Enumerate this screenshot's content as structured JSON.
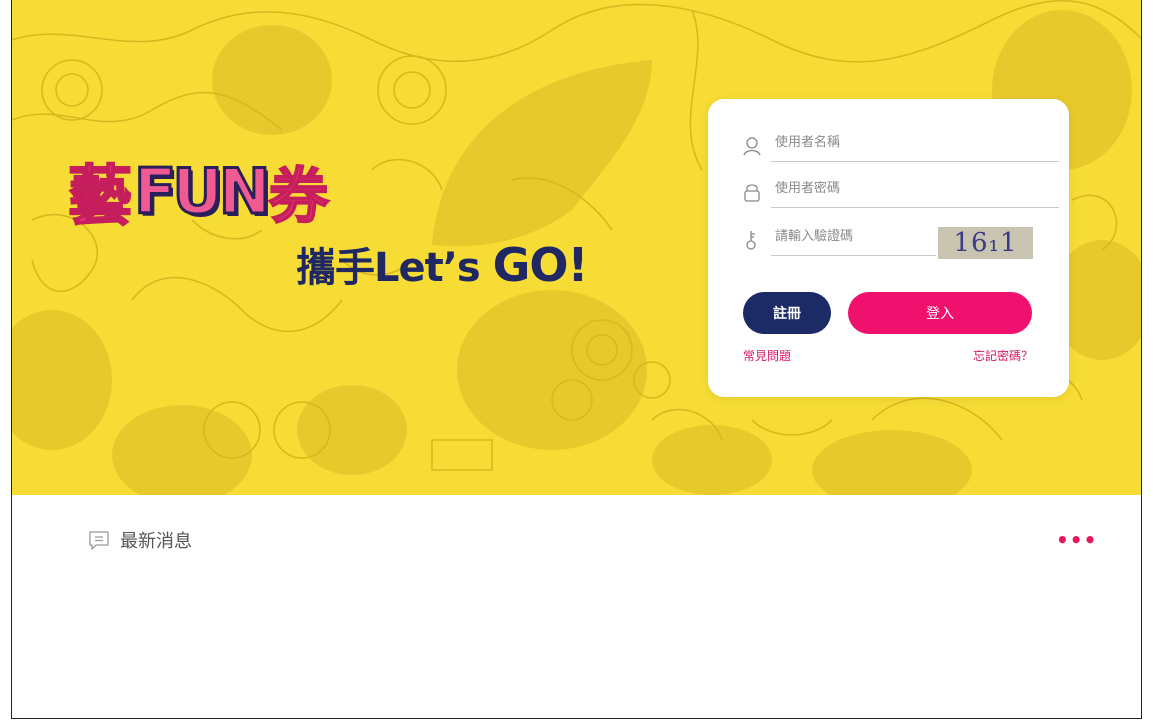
{
  "hero": {
    "logo": {
      "line1_yi": "藝",
      "line1_fun": "FUN",
      "line1_quan": "券",
      "line2_main": "攜手Let’s ",
      "line2_go": "GO!"
    }
  },
  "login": {
    "username": {
      "placeholder": "使用者名稱",
      "value": ""
    },
    "password": {
      "placeholder": "使用者密碼",
      "value": ""
    },
    "captcha_input": {
      "placeholder": "請輸入驗證碼",
      "value": ""
    },
    "captcha_text": "16₁1",
    "register_label": "註冊",
    "login_label": "登入",
    "faq_label": "常見問題",
    "forgot_label": "忘記密碼？"
  },
  "news": {
    "title": "最新消息",
    "more_label": "•••"
  },
  "colors": {
    "hero_bg": "#f7dc35",
    "register_bg": "#1c2a66",
    "login_bg": "#f0106e",
    "link": "#d81466"
  },
  "icons": [
    "user-icon",
    "lock-icon",
    "key-icon",
    "message-icon",
    "more-icon"
  ]
}
